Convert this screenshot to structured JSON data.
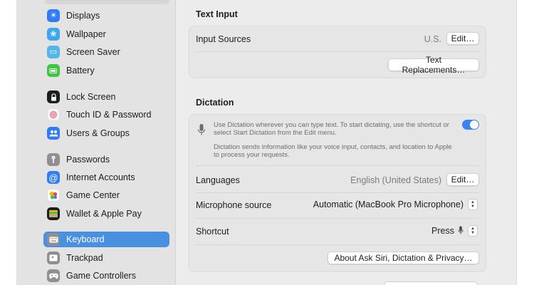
{
  "sidebar": {
    "items": [
      {
        "label": "Displays",
        "icon": "sun-icon",
        "color": "#2f7cf6"
      },
      {
        "label": "Wallpaper",
        "icon": "flower-icon",
        "color": "#3aa7f0"
      },
      {
        "label": "Screen Saver",
        "icon": "screen-saver-icon",
        "color": "#54b6e8"
      },
      {
        "label": "Battery",
        "icon": "battery-icon",
        "color": "#3ec63e"
      },
      {
        "label": "Lock Screen",
        "icon": "lock-icon",
        "color": "#1d1d1f"
      },
      {
        "label": "Touch ID & Password",
        "icon": "fingerprint-icon",
        "color": "#f0f0f0"
      },
      {
        "label": "Users & Groups",
        "icon": "users-icon",
        "color": "#2f7cf6"
      },
      {
        "label": "Passwords",
        "icon": "key-icon",
        "color": "#8e8e93"
      },
      {
        "label": "Internet Accounts",
        "icon": "at-icon",
        "color": "#2f7cf6"
      },
      {
        "label": "Game Center",
        "icon": "game-center-icon",
        "color": "#ffffff"
      },
      {
        "label": "Wallet & Apple Pay",
        "icon": "wallet-icon",
        "color": "#1d1d1f"
      },
      {
        "label": "Keyboard",
        "icon": "keyboard-icon",
        "color": "#8e8e93"
      },
      {
        "label": "Trackpad",
        "icon": "trackpad-icon",
        "color": "#8e8e93"
      },
      {
        "label": "Game Controllers",
        "icon": "game-controller-icon",
        "color": "#8e8e93"
      }
    ]
  },
  "text_input": {
    "title": "Text Input",
    "input_sources_label": "Input Sources",
    "input_sources_value": "U.S.",
    "edit_label": "Edit…",
    "text_replacements_label": "Text Replacements…"
  },
  "dictation": {
    "title": "Dictation",
    "description": "Use Dictation wherever you can type text. To start dictating, use the shortcut or select Start Dictation from the Edit menu.",
    "privacy_note": "Dictation sends information like your voice input, contacts, and location to Apple to process your requests.",
    "toggle_on": true,
    "languages_label": "Languages",
    "languages_value": "English (United States)",
    "edit_label": "Edit…",
    "microphone_label": "Microphone source",
    "microphone_value": "Automatic (MacBook Pro Microphone)",
    "shortcut_label": "Shortcut",
    "shortcut_value": "Press",
    "about_label": "About Ask Siri, Dictation & Privacy…"
  },
  "colors": {
    "accent": "#4a90e2",
    "toggle": "#3b82f6"
  }
}
